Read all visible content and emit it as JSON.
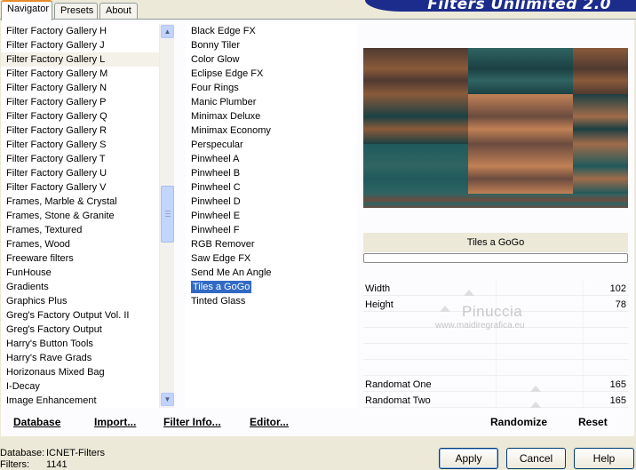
{
  "tabs": [
    {
      "label": "Navigator",
      "active": true
    },
    {
      "label": "Presets",
      "active": false
    },
    {
      "label": "About",
      "active": false
    }
  ],
  "banner_title": "Filters Unlimited 2.0",
  "categories": [
    "Filter Factory Gallery H",
    "Filter Factory Gallery J",
    "Filter Factory Gallery L",
    "Filter Factory Gallery M",
    "Filter Factory Gallery N",
    "Filter Factory Gallery P",
    "Filter Factory Gallery Q",
    "Filter Factory Gallery R",
    "Filter Factory Gallery S",
    "Filter Factory Gallery T",
    "Filter Factory Gallery U",
    "Filter Factory Gallery V",
    "Frames, Marble & Crystal",
    "Frames, Stone & Granite",
    "Frames, Textured",
    "Frames, Wood",
    "Freeware filters",
    "FunHouse",
    "Gradients",
    "Graphics Plus",
    "Greg's Factory Output Vol. II",
    "Greg's Factory Output",
    "Harry's Button Tools",
    "Harry's Rave Grads",
    "Horizonaus Mixed Bag",
    "I-Decay",
    "Image Enhancement"
  ],
  "filters": [
    "Black Edge FX",
    "Bonny Tiler",
    "Color Glow",
    "Eclipse Edge FX",
    "Four Rings",
    "Manic Plumber",
    "Minimax Deluxe",
    "Minimax Economy",
    "Perspecular",
    "Pinwheel A",
    "Pinwheel B",
    "Pinwheel C",
    "Pinwheel D",
    "Pinwheel E",
    "Pinwheel F",
    "RGB Remover",
    "Saw Edge FX",
    "Send Me An Angle",
    "Tiles a GoGo",
    "Tinted Glass"
  ],
  "selected_filter": "Tiles a GoGo",
  "filter_title": "Tiles a GoGo",
  "params": [
    {
      "label": "Width",
      "value": "102",
      "level": 0.4
    },
    {
      "label": "Height",
      "value": "78",
      "level": 0.31
    },
    {
      "label": "",
      "value": "",
      "level": null
    },
    {
      "label": "",
      "value": "",
      "level": null
    },
    {
      "label": "",
      "value": "",
      "level": null
    },
    {
      "label": "",
      "value": "",
      "level": null
    },
    {
      "label": "Randomat One",
      "value": "165",
      "level": 0.65
    },
    {
      "label": "Randomat Two",
      "value": "165",
      "level": 0.65
    }
  ],
  "watermark": {
    "line1": "Pinuccia",
    "line2": "www.maidiregrafica.eu"
  },
  "links": {
    "database": "Database",
    "import": "Import...",
    "filter_info": "Filter Info...",
    "editor": "Editor...",
    "randomize": "Randomize",
    "reset": "Reset"
  },
  "status": {
    "database_label": "Database:",
    "database_value": "ICNET-Filters",
    "filters_label": "Filters:",
    "filters_value": "1141"
  },
  "buttons": {
    "apply": "Apply",
    "cancel": "Cancel",
    "help": "Help"
  },
  "preview_colors": [
    "#4f3a31",
    "#2f6462",
    "#8a5a3a",
    "#c18155",
    "#205a5c",
    "#6b4b3f",
    "#1c4043",
    "#a06b4a"
  ]
}
